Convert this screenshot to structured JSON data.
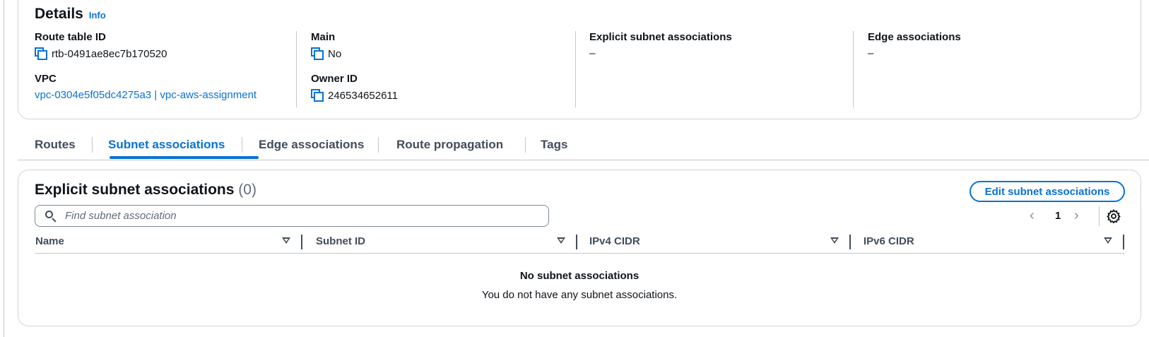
{
  "details": {
    "title": "Details",
    "info_link": "Info",
    "route_table_id": {
      "label": "Route table ID",
      "value": "rtb-0491ae8ec7b170520"
    },
    "vpc": {
      "label": "VPC",
      "value": "vpc-0304e5f05dc4275a3 | vpc-aws-assignment"
    },
    "main": {
      "label": "Main",
      "value": "No"
    },
    "owner_id": {
      "label": "Owner ID",
      "value": "246534652611"
    },
    "explicit_subnet_associations": {
      "label": "Explicit subnet associations",
      "value": "–"
    },
    "edge_associations": {
      "label": "Edge associations",
      "value": "–"
    }
  },
  "tabs": [
    {
      "label": "Routes",
      "active": false
    },
    {
      "label": "Subnet associations",
      "active": true
    },
    {
      "label": "Edge associations",
      "active": false
    },
    {
      "label": "Route propagation",
      "active": false
    },
    {
      "label": "Tags",
      "active": false
    }
  ],
  "subnet_panel": {
    "title": "Explicit subnet associations",
    "count": "(0)",
    "edit_button": "Edit subnet associations",
    "search_placeholder": "Find subnet association",
    "pagination": {
      "prev": "‹",
      "page": "1",
      "next": "›"
    },
    "columns": [
      "Name",
      "Subnet ID",
      "IPv4 CIDR",
      "IPv6 CIDR"
    ],
    "empty_title": "No subnet associations",
    "empty_description": "You do not have any subnet associations."
  },
  "colors": {
    "accent": "#0972d3",
    "text": "#0f141a",
    "secondary_text": "#414d5c",
    "border": "#c6c6cd"
  }
}
